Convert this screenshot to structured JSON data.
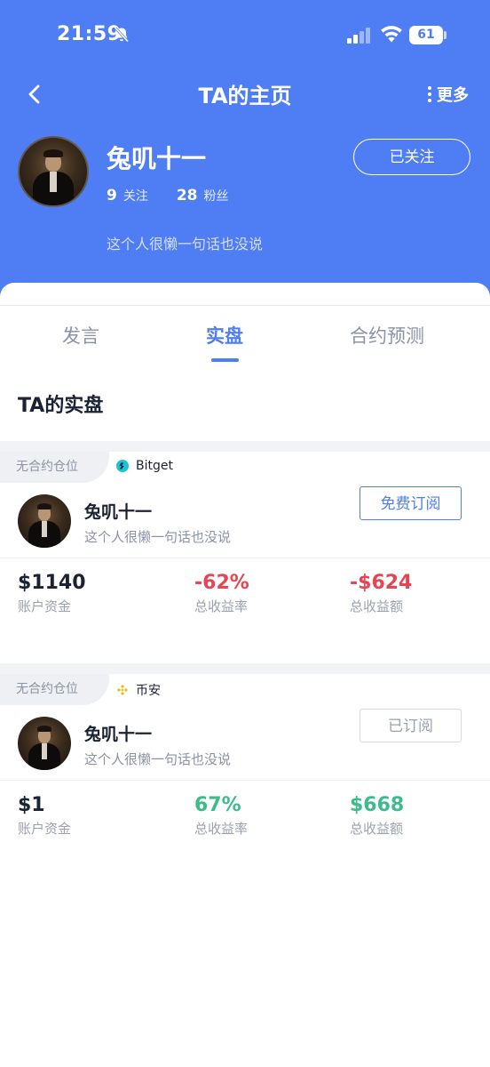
{
  "status_bar": {
    "time": "21:59",
    "battery": "61"
  },
  "nav": {
    "title": "TA的主页",
    "more_label": "更多"
  },
  "profile": {
    "name": "兔叽十一",
    "follow_label": "已关注",
    "following_count": "9",
    "following_label": "关注",
    "followers_count": "28",
    "followers_label": "粉丝",
    "bio": "这个人很懒一句话也没说"
  },
  "tabs": [
    {
      "label": "发言"
    },
    {
      "label": "实盘"
    },
    {
      "label": "合约预测"
    }
  ],
  "active_tab": "实盘",
  "section_title": "TA的实盘",
  "cards": [
    {
      "position_tag": "无合约仓位",
      "exchange": "Bitget",
      "name": "兔叽十一",
      "bio": "这个人很懒一句话也没说",
      "subscribe_label": "免费订阅",
      "metrics": [
        {
          "value": "$1140",
          "label": "账户资金"
        },
        {
          "value": "-62%",
          "label": "总收益率"
        },
        {
          "value": "-$624",
          "label": "总收益额"
        }
      ]
    },
    {
      "position_tag": "无合约仓位",
      "exchange": "币安",
      "name": "兔叽十一",
      "bio": "这个人很懒一句话也没说",
      "subscribe_label": "已订阅",
      "metrics": [
        {
          "value": "$1",
          "label": "账户资金"
        },
        {
          "value": "67%",
          "label": "总收益率"
        },
        {
          "value": "$668",
          "label": "总收益额"
        }
      ]
    }
  ],
  "colors": {
    "brand_blue": "#4f7df3",
    "loss_red": "#e64553",
    "gain_green": "#3dbb8a",
    "bitget_cyan": "#1cc3d8",
    "binance_gold": "#f0b90b"
  }
}
